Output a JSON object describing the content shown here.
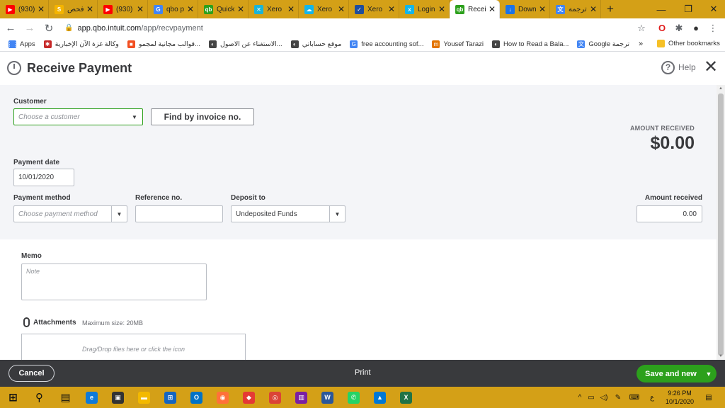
{
  "browser": {
    "tabs": [
      {
        "title": "(930)",
        "icon": "youtube-icon",
        "color": "#ff0000",
        "glyph": "▶"
      },
      {
        "title": "فحص",
        "icon": "s-icon",
        "color": "#f4b400",
        "glyph": "S"
      },
      {
        "title": "(930)",
        "icon": "youtube-icon",
        "color": "#ff0000",
        "glyph": "▶"
      },
      {
        "title": "qbo p",
        "icon": "google-icon",
        "color": "#4285f4",
        "glyph": "G"
      },
      {
        "title": "Quick",
        "icon": "quickbooks-icon",
        "color": "#2ca01c",
        "glyph": "qb"
      },
      {
        "title": "Xero",
        "icon": "xero-icon",
        "color": "#1ab4d7",
        "glyph": "✕"
      },
      {
        "title": "Xero",
        "icon": "cloud-icon",
        "color": "#13b5ea",
        "glyph": "☁"
      },
      {
        "title": "Xero",
        "icon": "check-icon",
        "color": "#1f4e9c",
        "glyph": "✓"
      },
      {
        "title": "Login",
        "icon": "xero-logo-icon",
        "color": "#13b5ea",
        "glyph": "x"
      },
      {
        "title": "Recei",
        "icon": "quickbooks-icon",
        "color": "#2ca01c",
        "glyph": "qb"
      },
      {
        "title": "Down",
        "icon": "download-icon",
        "color": "#1a73e8",
        "glyph": "↓"
      },
      {
        "title": "ترجمة",
        "icon": "translate-icon",
        "color": "#4285f4",
        "glyph": "文"
      }
    ],
    "new_tab": "+",
    "window": {
      "minimize": "—",
      "restore": "❐",
      "close": "✕"
    },
    "address": {
      "url_host": "app.qbo.intuit.com",
      "url_path": "/app/recvpayment"
    },
    "bookmarks": [
      {
        "label": "Apps",
        "icon": "apps-icon",
        "color": "#4285f4",
        "glyph": "⋮⋮"
      },
      {
        "label": "وكالة غزة الآن الإخبارية",
        "icon": "news-icon",
        "color": "#c62828",
        "glyph": "✱"
      },
      {
        "label": "قوالب مجانية لمجمو...",
        "icon": "microsoft-icon",
        "color": "#f25022",
        "glyph": "■"
      },
      {
        "label": "الاستغناء عن الاصول...",
        "icon": "web-icon",
        "color": "#444444",
        "glyph": "◐"
      },
      {
        "label": "موقع حساباتي",
        "icon": "web-icon",
        "color": "#444444",
        "glyph": "◐"
      },
      {
        "label": "free accounting sof...",
        "icon": "google-icon",
        "color": "#4285f4",
        "glyph": "G"
      },
      {
        "label": "Yousef Tarazi",
        "icon": "site-icon",
        "color": "#e37400",
        "glyph": "m"
      },
      {
        "label": "How to Read a Bala...",
        "icon": "web-icon",
        "color": "#444444",
        "glyph": "◐"
      },
      {
        "label": "Google ترجمة",
        "icon": "translate-icon",
        "color": "#4285f4",
        "glyph": "文"
      }
    ],
    "more": "»",
    "other_bookmarks": "Other bookmarks"
  },
  "page": {
    "title": "Receive Payment",
    "help": "Help",
    "customer_label": "Customer",
    "customer_placeholder": "Choose a customer",
    "find_invoice": "Find by invoice no.",
    "amount_received_label": "AMOUNT RECEIVED",
    "amount_received_value": "$0.00",
    "payment_date_label": "Payment date",
    "payment_date": "10/01/2020",
    "payment_method_label": "Payment method",
    "payment_method_placeholder": "Choose payment method",
    "reference_label": "Reference no.",
    "reference_value": "",
    "deposit_label": "Deposit to",
    "deposit_value": "Undeposited Funds",
    "amount_field_label": "Amount received",
    "amount_field_value": "0.00",
    "memo_label": "Memo",
    "memo_placeholder": "Note",
    "attachments_label": "Attachments",
    "attachments_max": "Maximum size: 20MB",
    "dropzone_text": "Drag/Drop files here or click the icon"
  },
  "footer": {
    "cancel": "Cancel",
    "print": "Print",
    "save": "Save and new"
  },
  "taskbar": {
    "apps": [
      {
        "name": "start-icon",
        "color": "#111111",
        "glyph": "⊞"
      },
      {
        "name": "search-icon",
        "color": "#111111",
        "glyph": "⚲"
      },
      {
        "name": "task-view-icon",
        "color": "#111111",
        "glyph": "▤"
      },
      {
        "name": "edge-icon",
        "color": "#0f7ad8",
        "glyph": "e"
      },
      {
        "name": "store-icon",
        "color": "#333333",
        "glyph": "▣"
      },
      {
        "name": "file-explorer-icon",
        "color": "#f3b900",
        "glyph": "▬"
      },
      {
        "name": "network-icon",
        "color": "#1565c0",
        "glyph": "⊞"
      },
      {
        "name": "outlook-icon",
        "color": "#0072c6",
        "glyph": "O"
      },
      {
        "name": "firefox-icon",
        "color": "#ff7139",
        "glyph": "◉"
      },
      {
        "name": "anydesk-icon",
        "color": "#e53935",
        "glyph": "◆"
      },
      {
        "name": "chrome-icon",
        "color": "#db4437",
        "glyph": "◎"
      },
      {
        "name": "winrar-icon",
        "color": "#7b1fa2",
        "glyph": "▥"
      },
      {
        "name": "word-icon",
        "color": "#2b579a",
        "glyph": "W"
      },
      {
        "name": "whatsapp-icon",
        "color": "#25d366",
        "glyph": "✆"
      },
      {
        "name": "photos-icon",
        "color": "#0078d4",
        "glyph": "▲"
      },
      {
        "name": "excel-icon",
        "color": "#217346",
        "glyph": "X"
      }
    ],
    "tray": {
      "chevron": "^",
      "lang": "ع",
      "time": "9:26 PM",
      "date": "10/1/2020"
    }
  }
}
